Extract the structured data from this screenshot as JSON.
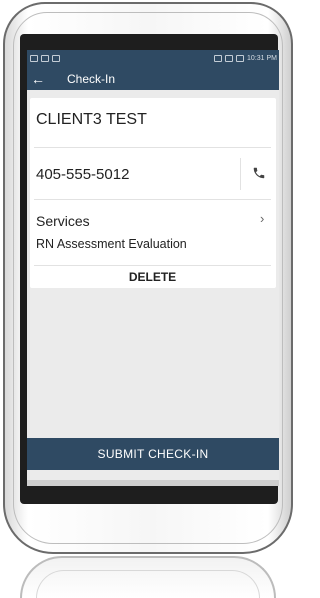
{
  "status_bar": {
    "time": "10:31 PM"
  },
  "app_bar": {
    "title": "Check-In",
    "back_icon": "arrow-left-icon"
  },
  "client": {
    "name": "CLIENT3 TEST",
    "phone": "405-555-5012",
    "call_icon": "phone-icon"
  },
  "services": {
    "label": "Services",
    "value": "RN Assessment Evaluation",
    "chevron_icon": "chevron-right-icon"
  },
  "actions": {
    "delete_label": "DELETE",
    "submit_label": "SUBMIT CHECK-IN"
  },
  "colors": {
    "primary": "#2f4a63",
    "background": "#ebebeb",
    "card": "#ffffff"
  }
}
